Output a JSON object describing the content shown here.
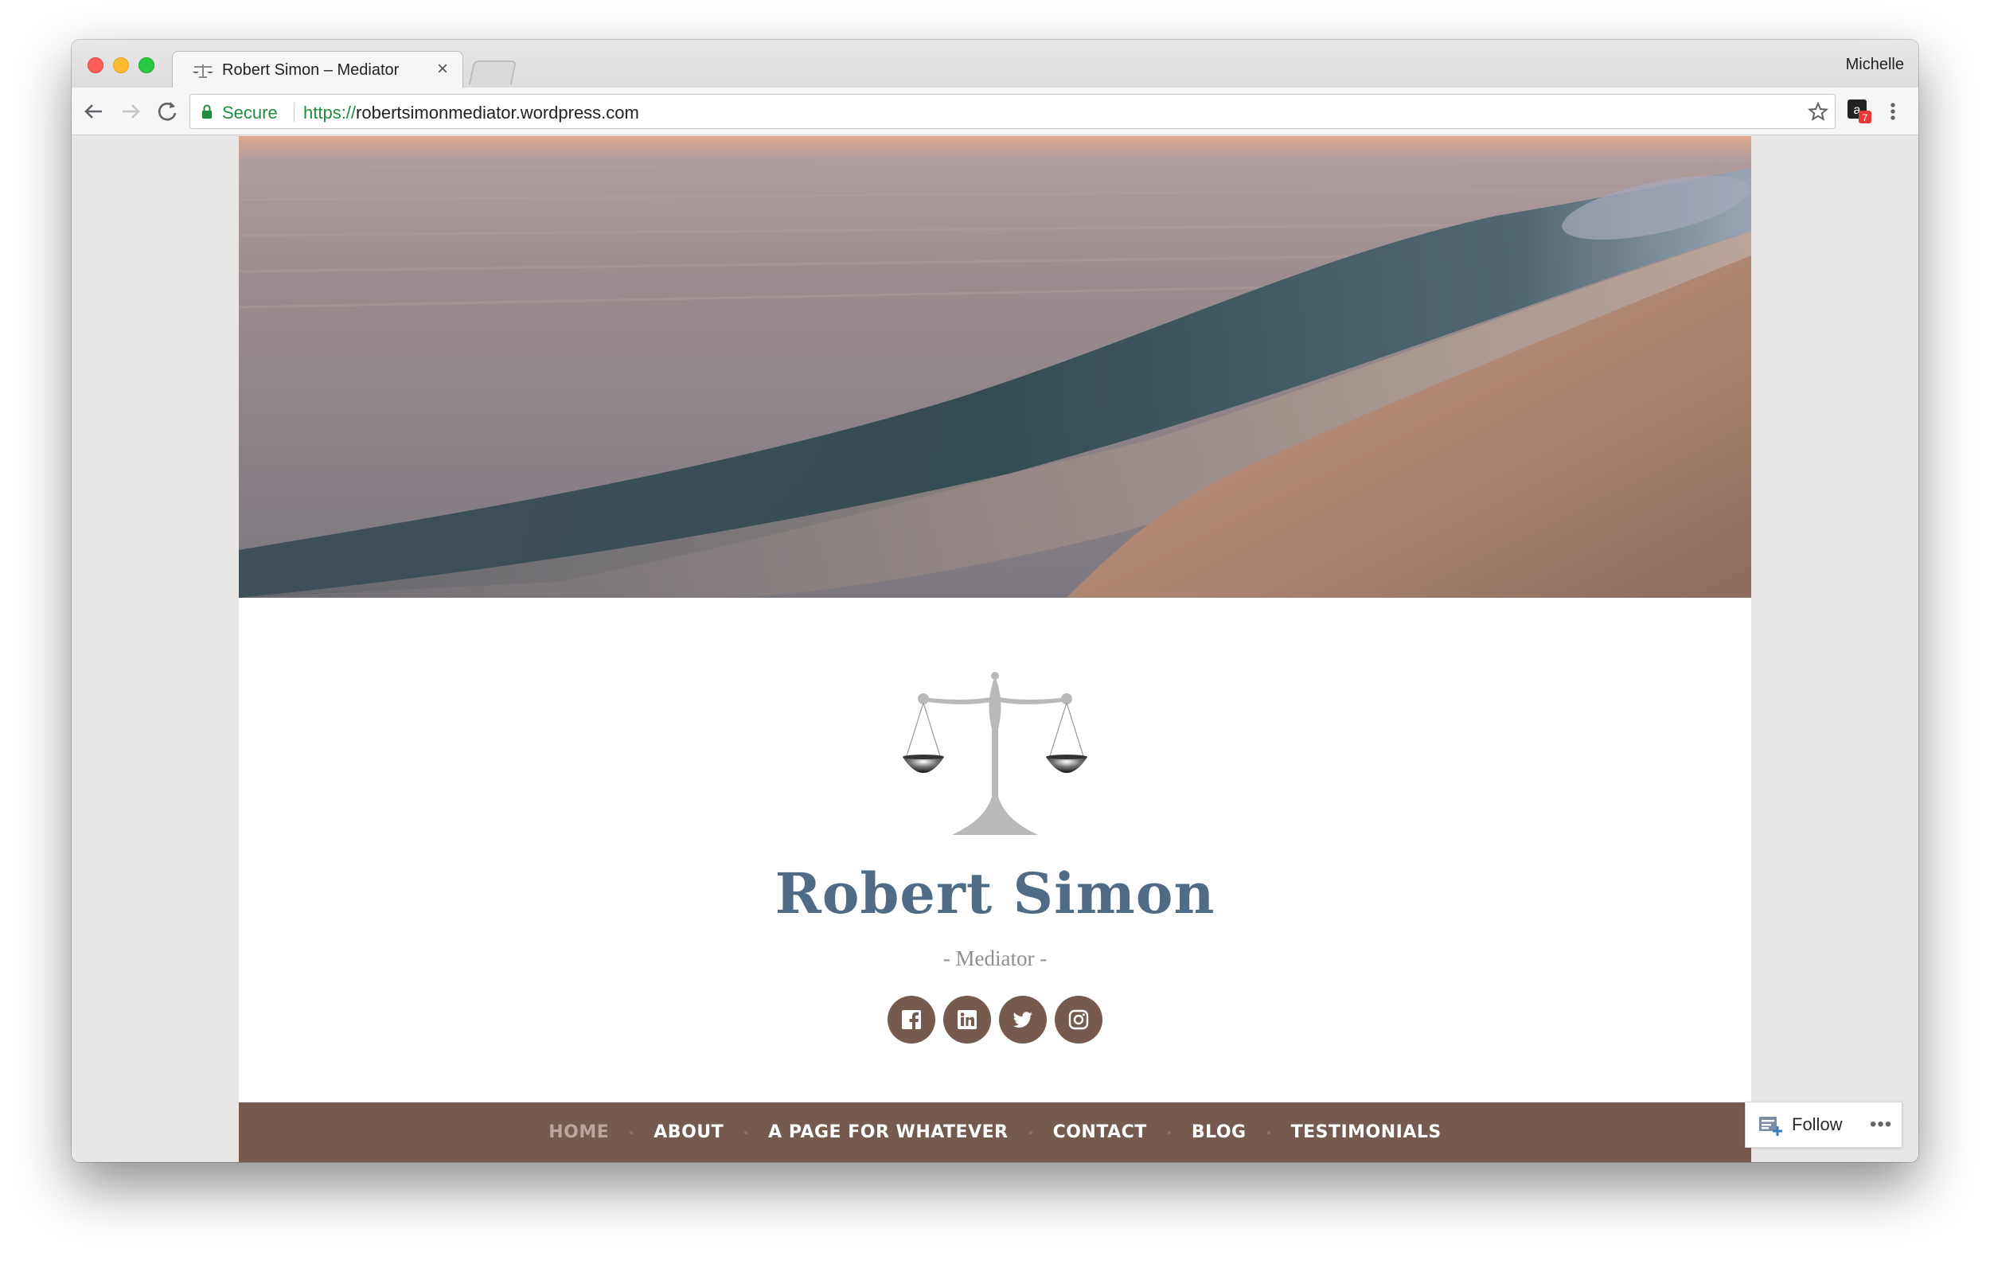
{
  "browser": {
    "tab_title": "Robert Simon – Mediator",
    "tab_close": "×",
    "profile_name": "Michelle",
    "secure_label": "Secure",
    "url_scheme": "https://",
    "url_host": "robertsimonmediator.wordpress.com",
    "extension_badge": "7"
  },
  "site": {
    "title": "Robert Simon",
    "description": "- Mediator -",
    "social": [
      {
        "name": "facebook-icon"
      },
      {
        "name": "linkedin-icon"
      },
      {
        "name": "twitter-icon"
      },
      {
        "name": "instagram-icon"
      }
    ],
    "nav": [
      {
        "label": "HOME",
        "current": true
      },
      {
        "label": "ABOUT"
      },
      {
        "label": "A PAGE FOR WHATEVER"
      },
      {
        "label": "CONTACT"
      },
      {
        "label": "BLOG"
      },
      {
        "label": "TESTIMONIALS"
      }
    ],
    "colors": {
      "accent": "#755a4d",
      "title": "#4f6b86",
      "nav_current": "#bca59a"
    }
  },
  "follow": {
    "label": "Follow",
    "more": "•••"
  }
}
